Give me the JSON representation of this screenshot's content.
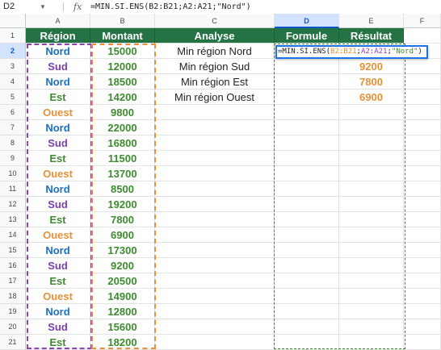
{
  "formula_bar": {
    "cell_ref": "D2",
    "fx_label": "fx",
    "formula": "=MIN.SI.ENS(B2:B21;A2:A21;\"Nord\")"
  },
  "columns": [
    "A",
    "B",
    "C",
    "D",
    "E",
    "F"
  ],
  "selected_column": "D",
  "selected_row": "2",
  "rows": [
    "1",
    "2",
    "3",
    "4",
    "5",
    "6",
    "7",
    "8",
    "9",
    "10",
    "11",
    "12",
    "13",
    "14",
    "15",
    "16",
    "17",
    "18",
    "19",
    "20",
    "21"
  ],
  "headers": [
    "Région",
    "Montant",
    "Analyse",
    "Formule",
    "Résultat"
  ],
  "data_rows": [
    {
      "region": "Nord",
      "amount": "15000"
    },
    {
      "region": "Sud",
      "amount": "12000"
    },
    {
      "region": "Nord",
      "amount": "18500"
    },
    {
      "region": "Est",
      "amount": "14200"
    },
    {
      "region": "Ouest",
      "amount": "9800"
    },
    {
      "region": "Nord",
      "amount": "22000"
    },
    {
      "region": "Sud",
      "amount": "16800"
    },
    {
      "region": "Est",
      "amount": "11500"
    },
    {
      "region": "Ouest",
      "amount": "13700"
    },
    {
      "region": "Nord",
      "amount": "8500"
    },
    {
      "region": "Sud",
      "amount": "19200"
    },
    {
      "region": "Est",
      "amount": "7800"
    },
    {
      "region": "Ouest",
      "amount": "6900"
    },
    {
      "region": "Nord",
      "amount": "17300"
    },
    {
      "region": "Sud",
      "amount": "9200"
    },
    {
      "region": "Est",
      "amount": "20500"
    },
    {
      "region": "Ouest",
      "amount": "14900"
    },
    {
      "region": "Nord",
      "amount": "12800"
    },
    {
      "region": "Sud",
      "amount": "15600"
    },
    {
      "region": "Est",
      "amount": "18200"
    }
  ],
  "analysis": [
    {
      "label": "Min région Nord",
      "result": ""
    },
    {
      "label": "Min région Sud",
      "result": "9200"
    },
    {
      "label": "Min région Est",
      "result": "7800"
    },
    {
      "label": "Min région Ouest",
      "result": "6900"
    }
  ],
  "editor": {
    "eq": "=MIN.SI.ENS(",
    "arg1": "B2:B21",
    "sep1": ";",
    "arg2": "A2:A21",
    "sep2": ";",
    "arg3": "\"Nord\"",
    "close": ")"
  },
  "colors": {
    "header_bg": "#257245",
    "Nord": "#1f6fbf",
    "Sud": "#7a3fb0",
    "Est": "#3d8b2f",
    "Ouest": "#e69138",
    "amount": "#3d8b2f",
    "result": "#e69138",
    "range_A": "#8e44ad",
    "range_B": "#e69138",
    "range_E": "#3d8b2f",
    "selection": "#1a73e8"
  }
}
